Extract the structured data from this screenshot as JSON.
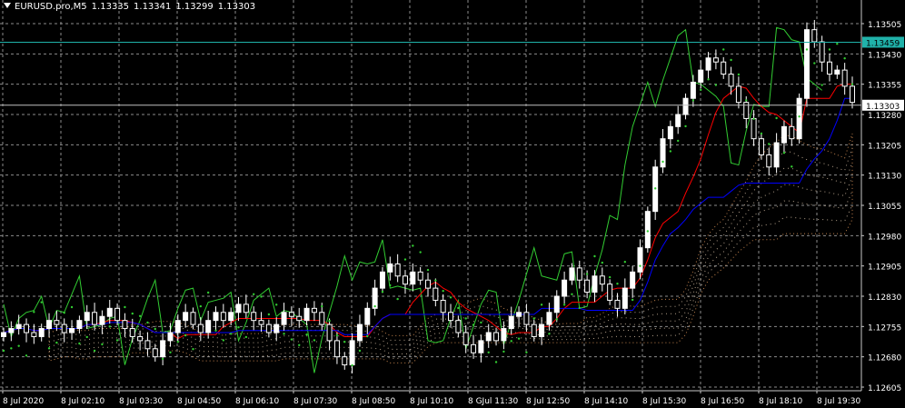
{
  "header": {
    "symbol": "EURUSD.pro,M5",
    "open": "1.13335",
    "high": "1.13341",
    "low": "1.13299",
    "close": "1.13303"
  },
  "colors": {
    "background": "#000000",
    "grid": "#8c8c8c",
    "bull_candle": "#ffffff",
    "bear_candle": "#ffffff",
    "tenkan": "#ff0000",
    "kijun": "#0000ff",
    "chikou": "#32cd32",
    "cloud_a": "#f4a460",
    "cloud_b": "#ffe4c4",
    "parabolic_sar": "#32cd32",
    "price_line": "#20b2aa",
    "ask_line": "#c0c0c0"
  },
  "chart_data": {
    "type": "candlestick",
    "symbol": "EURUSD.pro",
    "timeframe": "M5",
    "ylim": [
      1.12605,
      1.13505
    ],
    "y_ticks": [
      "1.13505",
      "1.13430",
      "1.13355",
      "1.13280",
      "1.13205",
      "1.13130",
      "1.13055",
      "1.12980",
      "1.12905",
      "1.12830",
      "1.12755",
      "1.12680",
      "1.12605"
    ],
    "x_ticks": [
      "8 Jul 2020",
      "8 Jul 02:10",
      "8 Jul 03:30",
      "8 Jul 04:50",
      "8 Jul 06:10",
      "8 Jul 07:30",
      "8 Jul 08:50",
      "8 Jul 10:10",
      "8 GJul 11:30",
      "8 Jul 12:50",
      "8 Jul 14:10",
      "8 Jul 15:30",
      "8 Jul 16:50",
      "8 Jul 18:10",
      "8 Jul 19:30"
    ],
    "price_labels": [
      {
        "value": 1.13459,
        "text": "1.13459",
        "kind": "bid"
      },
      {
        "value": 1.13303,
        "text": "1.13303",
        "kind": "last"
      }
    ],
    "series": [
      {
        "name": "Close",
        "values": [
          1.1274,
          1.1275,
          1.1276,
          1.1274,
          1.1273,
          1.1275,
          1.1277,
          1.1276,
          1.1274,
          1.1275,
          1.1277,
          1.1279,
          1.1276,
          1.1278,
          1.128,
          1.1277,
          1.1275,
          1.1273,
          1.1272,
          1.127,
          1.1268,
          1.1272,
          1.1274,
          1.1277,
          1.1279,
          1.1276,
          1.1274,
          1.1277,
          1.1279,
          1.1277,
          1.1279,
          1.1281,
          1.1279,
          1.1277,
          1.1276,
          1.1274,
          1.1276,
          1.1279,
          1.1278,
          1.1277,
          1.128,
          1.1279,
          1.1276,
          1.1272,
          1.1268,
          1.1266,
          1.1272,
          1.1276,
          1.128,
          1.1285,
          1.1289,
          1.1291,
          1.1288,
          1.1286,
          1.1289,
          1.1287,
          1.1285,
          1.1282,
          1.1279,
          1.1277,
          1.1274,
          1.1271,
          1.1269,
          1.1272,
          1.1274,
          1.1272,
          1.1275,
          1.1278,
          1.1279,
          1.1276,
          1.1273,
          1.1276,
          1.1279,
          1.1283,
          1.1287,
          1.129,
          1.1287,
          1.1284,
          1.1288,
          1.1286,
          1.1282,
          1.128,
          1.1285,
          1.1289,
          1.1295,
          1.1304,
          1.1315,
          1.1322,
          1.1325,
          1.1328,
          1.1332,
          1.1336,
          1.1339,
          1.1342,
          1.1341,
          1.1338,
          1.1335,
          1.1331,
          1.1327,
          1.1322,
          1.1318,
          1.1315,
          1.1321,
          1.1325,
          1.1322,
          1.1332,
          1.1349,
          1.1346,
          1.1341,
          1.1338,
          1.1339,
          1.1335,
          1.1331
        ]
      }
    ]
  }
}
